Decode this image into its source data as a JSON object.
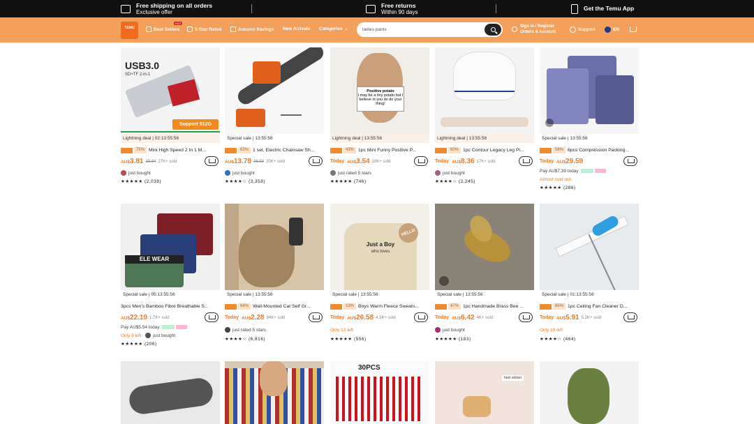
{
  "topbar": {
    "shipping": "Free shipping on all orders",
    "shipping_sub": "Exclusive offer",
    "returns": "Free returns",
    "returns_sub": "Within 90 days",
    "app": "Get the Temu App"
  },
  "nav": {
    "logo": "TEMU",
    "hot": "HOT",
    "items": [
      "Best Sellers",
      "5-Star Rated",
      "Autumn Savings",
      "New Arrivals",
      "Categories"
    ],
    "search_value": "ladies pants",
    "signin": "Sign in / Register",
    "orders": "Orders & Account",
    "support": "Support",
    "lang": "EN"
  },
  "products": [
    {
      "deal": "Lightning deal | 02:13:55:56",
      "pct": "75%",
      "title": "Mini High Speed 2 In 1 M...",
      "price_cur": "AU$",
      "price": "3.81",
      "old": "15.84",
      "sold": "27K+ sold",
      "meta": "just bought",
      "stars": "★★★★★ (2,038)",
      "overlay": "Support 512G",
      "image_text": "USB3.0",
      "image_subtext": "SD+TF 2-in-1"
    },
    {
      "deal": "Special sale | 13:55:56",
      "pct": "63%",
      "title": "1 set, Electric Chainsaw Sh...",
      "price_cur": "AU$",
      "price": "13.78",
      "old": "36.93",
      "sold": "20K+ sold",
      "meta": "just bought",
      "stars": "★★★★☆ (3,358)"
    },
    {
      "deal": "Lightning deal | 13:55:56",
      "pct": "43%",
      "title": "1pc Mini Funny Positive P...",
      "today": "Today",
      "price_cur": "AU$",
      "price": "3.54",
      "old": "",
      "sold": "18K+ sold",
      "meta": "just rated 5 stars",
      "stars": "★★★★★ (746)",
      "image_text": "Positive potato",
      "image_subtext": "I may be a tiny potato but I believe in you do do your thing!"
    },
    {
      "deal": "Lightning deal | 13:55:56",
      "pct": "60%",
      "title": "1pc Contour Legacy Leg Pi...",
      "today": "Today",
      "price_cur": "AU$",
      "price": "8.36",
      "old": "",
      "sold": "17K+ sold",
      "meta": "just bought",
      "stars": "★★★★☆ (2,245)"
    },
    {
      "deal": "Special sale | 13:55:56",
      "pct": "56%",
      "title": "6pcs Compression Packing...",
      "today": "Today",
      "price_cur": "AU$",
      "price": "29.59",
      "old": "",
      "sold": "",
      "meta": "Pay AU$7.39 today",
      "extra": "Almost sold out",
      "stars": "★★★★★ (286)"
    },
    {
      "deal": "Special sale | 05:13:55:56",
      "pct": "",
      "title": "3pcs Men's Bamboo Fibre Breathable S...",
      "price_cur": "AU$",
      "price": "22.19",
      "old": "",
      "sold": "1.7K+ sold",
      "meta": "Pay AU$5.54 today",
      "extra": "Only 9 left",
      "meta2": "just bought",
      "stars": "(206)",
      "image_text": "ELE WEAR"
    },
    {
      "deal": "Special sale | 13:55:56",
      "pct": "64%",
      "title": "Wall-Mounted Cat Self Gr...",
      "today": "Today",
      "price_cur": "AU$",
      "price": "2.28",
      "old": "",
      "sold": "94K+ sold",
      "meta": "just rated 5 stars",
      "stars": "★★★★☆ (6,816)"
    },
    {
      "deal": "Special sale | 13:55:56",
      "pct": "13%",
      "title": "Boys Warm Fleece Sweats...",
      "today": "Today",
      "price_cur": "AU$",
      "price": "26.58",
      "old": "",
      "sold": "4.5K+ sold",
      "meta": "Only 12 left",
      "stars": "★★★★★ (556)",
      "image_text": "Just a Boy",
      "image_subtext": "who loves",
      "image_label": "HELLO"
    },
    {
      "deal": "Special sale | 13:55:56",
      "pct": "47%",
      "title": "1pc Handmade Brass Bee ...",
      "today": "Today",
      "price_cur": "AU$",
      "price": "6.42",
      "old": "",
      "sold": "4K+ sold",
      "meta": "just bought",
      "stars": "★★★★★ (183)"
    },
    {
      "deal": "Special sale | 01:13:55:56",
      "pct": "65%",
      "title": "1pc Ceiling Fan Cleaner D...",
      "today": "Today",
      "price_cur": "AU$",
      "price": "5.91",
      "old": "",
      "sold": "5.2K+ sold",
      "meta": "Only 19 left",
      "stars": "★★★★☆ (464)"
    }
  ],
  "row3": {
    "img3_text": "30PCS",
    "img4_text": "heel sticker"
  },
  "colors": {
    "nav_bg": "#f5a05a",
    "accent": "#f07820",
    "topbar_bg": "#111111"
  }
}
